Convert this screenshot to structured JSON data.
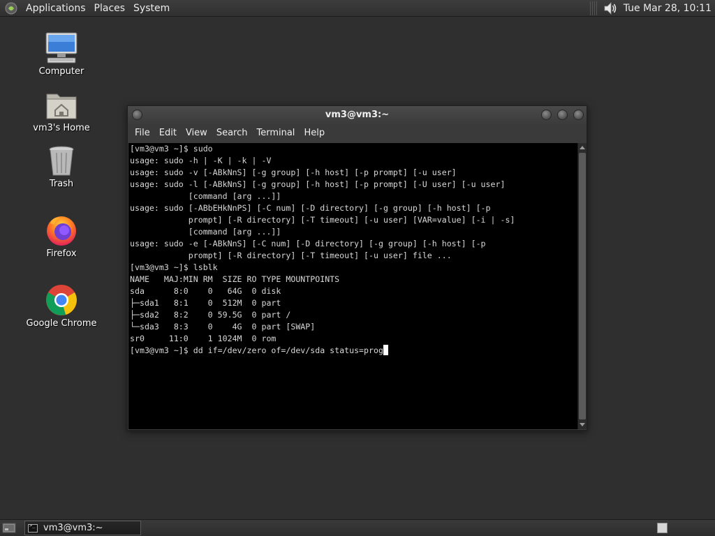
{
  "top_panel": {
    "menus": [
      "Applications",
      "Places",
      "System"
    ],
    "clock": "Tue Mar 28, 10:11"
  },
  "desktop_icons": [
    {
      "label": "Computer",
      "icon": "computer-icon"
    },
    {
      "label": "vm3's Home",
      "icon": "home-folder-icon"
    },
    {
      "label": "Trash",
      "icon": "trash-icon"
    },
    {
      "label": "Firefox",
      "icon": "firefox-icon"
    },
    {
      "label": "Google Chrome",
      "icon": "chrome-icon"
    }
  ],
  "terminal": {
    "title": "vm3@vm3:~",
    "menus": [
      "File",
      "Edit",
      "View",
      "Search",
      "Terminal",
      "Help"
    ],
    "lines": [
      "[vm3@vm3 ~]$ sudo",
      "usage: sudo -h | -K | -k | -V",
      "usage: sudo -v [-ABkNnS] [-g group] [-h host] [-p prompt] [-u user]",
      "usage: sudo -l [-ABkNnS] [-g group] [-h host] [-p prompt] [-U user] [-u user]",
      "            [command [arg ...]]",
      "usage: sudo [-ABbEHkNnPS] [-C num] [-D directory] [-g group] [-h host] [-p",
      "            prompt] [-R directory] [-T timeout] [-u user] [VAR=value] [-i | -s]",
      "            [command [arg ...]]",
      "usage: sudo -e [-ABkNnS] [-C num] [-D directory] [-g group] [-h host] [-p",
      "            prompt] [-R directory] [-T timeout] [-u user] file ...",
      "[vm3@vm3 ~]$ lsblk",
      "NAME   MAJ:MIN RM  SIZE RO TYPE MOUNTPOINTS",
      "sda      8:0    0   64G  0 disk",
      "├─sda1   8:1    0  512M  0 part",
      "├─sda2   8:2    0 59.5G  0 part /",
      "└─sda3   8:3    0    4G  0 part [SWAP]",
      "sr0     11:0    1 1024M  0 rom"
    ],
    "current_input": "[vm3@vm3 ~]$ dd if=/dev/zero of=/dev/sda status=prog"
  },
  "taskbar": {
    "window_button": "vm3@vm3:~"
  }
}
